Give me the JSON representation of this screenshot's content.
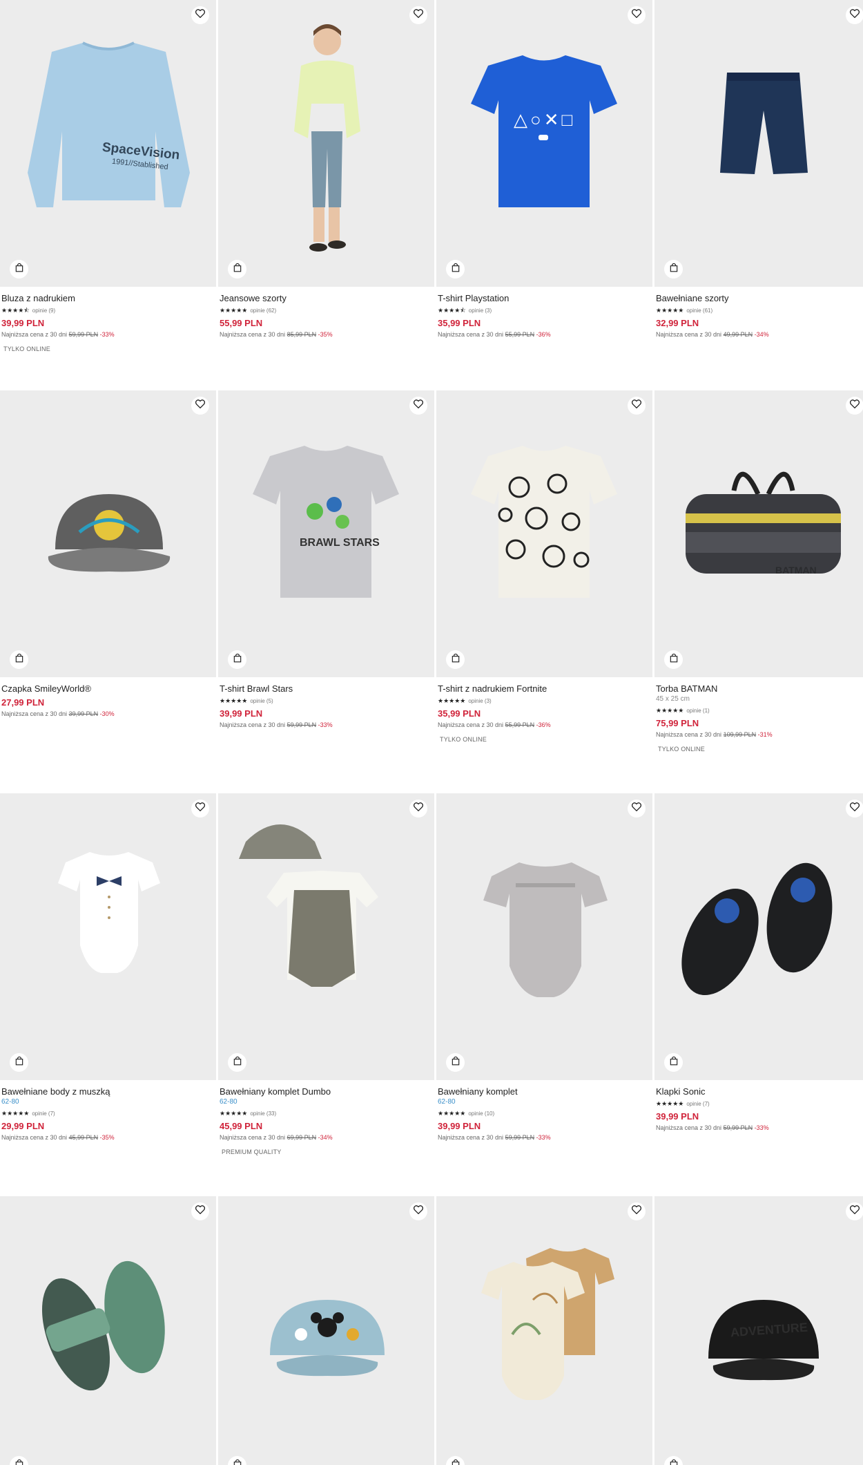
{
  "colors": {
    "price": "#d0233a",
    "sizes": "#3a8fc9",
    "image_bg": "#ececec"
  },
  "products": [
    {
      "title": "Bluza z nadrukiem",
      "stars": "★★★★⯪",
      "reviews": "opinie (9)",
      "price": "39,99 PLN",
      "lowest_label": "Najniższa cena z 30 dni",
      "old_price": "59,99 PLN",
      "discount": "-33%",
      "badge": "TYLKO ONLINE",
      "icon": "sweatshirt"
    },
    {
      "title": "Jeansowe szorty",
      "stars": "★★★★★",
      "reviews": "opinie (62)",
      "price": "55,99 PLN",
      "lowest_label": "Najniższa cena z 30 dni",
      "old_price": "85,99 PLN",
      "discount": "-35%",
      "icon": "boy"
    },
    {
      "title": "T-shirt Playstation",
      "stars": "★★★★⯪",
      "reviews": "opinie (3)",
      "price": "35,99 PLN",
      "lowest_label": "Najniższa cena z 30 dni",
      "old_price": "55,99 PLN",
      "discount": "-36%",
      "icon": "tshirt-blue"
    },
    {
      "title": "Bawełniane szorty",
      "stars": "★★★★★",
      "reviews": "opinie (61)",
      "price": "32,99 PLN",
      "lowest_label": "Najniższa cena z 30 dni",
      "old_price": "49,99 PLN",
      "discount": "-34%",
      "icon": "shorts"
    },
    {
      "title": "Czapka SmileyWorld®",
      "price": "27,99 PLN",
      "lowest_label": "Najniższa cena z 30 dni",
      "old_price": "39,99 PLN",
      "discount": "-30%",
      "icon": "cap-grey"
    },
    {
      "title": "T-shirt Brawl Stars",
      "stars": "★★★★★",
      "reviews": "opinie (5)",
      "price": "39,99 PLN",
      "lowest_label": "Najniższa cena z 30 dni",
      "old_price": "59,99 PLN",
      "discount": "-33%",
      "icon": "tshirt-grey"
    },
    {
      "title": "T-shirt z nadrukiem Fortnite",
      "stars": "★★★★★",
      "reviews": "opinie (3)",
      "price": "35,99 PLN",
      "lowest_label": "Najniższa cena z 30 dni",
      "old_price": "55,99 PLN",
      "discount": "-36%",
      "badge": "TYLKO ONLINE",
      "icon": "tshirt-print"
    },
    {
      "title": "Torba BATMAN",
      "sub": "45 x 25 cm",
      "stars": "★★★★★",
      "reviews": "opinie (1)",
      "price": "75,99 PLN",
      "lowest_label": "Najniższa cena z 30 dni",
      "old_price": "109,99 PLN",
      "discount": "-31%",
      "badge": "TYLKO ONLINE",
      "icon": "bag"
    },
    {
      "title": "Bawełniane body z muszką",
      "sizes": "62-80",
      "stars": "★★★★★",
      "reviews": "opinie (7)",
      "price": "29,99 PLN",
      "lowest_label": "Najniższa cena z 30 dni",
      "old_price": "45,99 PLN",
      "discount": "-35%",
      "icon": "body-white"
    },
    {
      "title": "Bawełniany komplet Dumbo",
      "sizes": "62-80",
      "stars": "★★★★★",
      "reviews": "opinie (33)",
      "price": "45,99 PLN",
      "lowest_label": "Najniższa cena z 30 dni",
      "old_price": "69,99 PLN",
      "discount": "-34%",
      "badge": "PREMIUM QUALITY",
      "icon": "set-dumbo"
    },
    {
      "title": "Bawełniany komplet",
      "sizes": "62-80",
      "stars": "★★★★★",
      "reviews": "opinie (10)",
      "price": "39,99 PLN",
      "lowest_label": "Najniższa cena z 30 dni",
      "old_price": "59,99 PLN",
      "discount": "-33%",
      "icon": "romper-grey"
    },
    {
      "title": "Klapki Sonic",
      "stars": "★★★★★",
      "reviews": "opinie (7)",
      "price": "39,99 PLN",
      "lowest_label": "Najniższa cena z 30 dni",
      "old_price": "59,99 PLN",
      "discount": "-33%",
      "icon": "slides-black"
    },
    {
      "title": "",
      "icon": "slides-green"
    },
    {
      "title": "",
      "icon": "cap-denim"
    },
    {
      "title": "",
      "icon": "body-set"
    },
    {
      "title": "",
      "icon": "cap-black"
    }
  ]
}
